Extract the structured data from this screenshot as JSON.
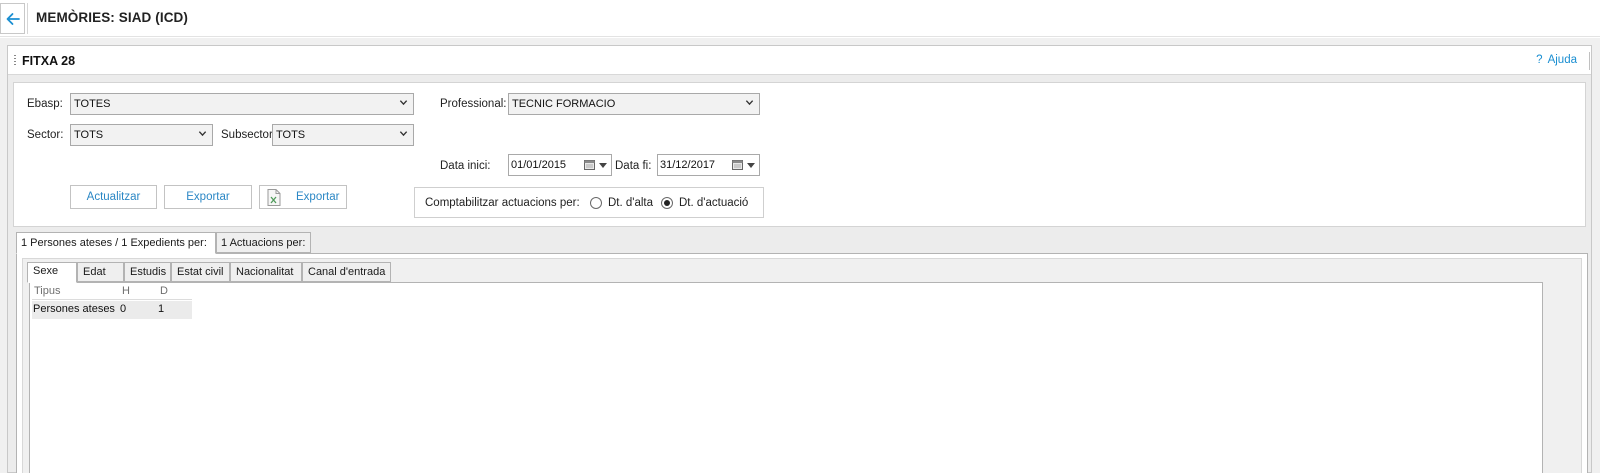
{
  "header": {
    "title": "MEMÒRIES: SIAD (ICD)",
    "back_icon": "arrow-left-icon",
    "accent": "#1b8fd2"
  },
  "panel": {
    "title": "FITXA 28",
    "help_label": "Ajuda",
    "help_icon": "?"
  },
  "filters": {
    "ebasp": {
      "label": "Ebasp:",
      "value": "TOTES"
    },
    "sector": {
      "label": "Sector:",
      "value": "TOTS"
    },
    "subsector": {
      "label": "Subsector",
      "value": "TOTS"
    },
    "professional": {
      "label": "Professional:",
      "value": "TECNIC FORMACIO"
    },
    "data_inici": {
      "label": "Data inici:",
      "value": "01/01/2015"
    },
    "data_fi": {
      "label": "Data fi:",
      "value": "31/12/2017"
    }
  },
  "buttons": {
    "update": "Actualitzar",
    "export": "Exportar",
    "export_excel": "Exportar"
  },
  "count_by": {
    "label": "Comptabilitzar actuacions per:",
    "options": [
      {
        "label": "Dt. d'alta",
        "checked": false
      },
      {
        "label": "Dt. d'actuació",
        "checked": true
      }
    ]
  },
  "outer_tabs": [
    {
      "label": "1 Persones ateses / 1 Expedients per:",
      "active": true
    },
    {
      "label": "1 Actuacions per:",
      "active": false
    }
  ],
  "inner_tabs": [
    {
      "label": "Sexe",
      "active": true
    },
    {
      "label": "Edat",
      "active": false
    },
    {
      "label": "Estudis",
      "active": false
    },
    {
      "label": "Estat civil",
      "active": false
    },
    {
      "label": "Nacionalitat",
      "active": false
    },
    {
      "label": "Canal d'entrada",
      "active": false
    }
  ],
  "grid": {
    "columns": [
      "Tipus",
      "H",
      "D"
    ],
    "rows": [
      [
        "Persones ateses",
        "0",
        "1"
      ]
    ]
  }
}
